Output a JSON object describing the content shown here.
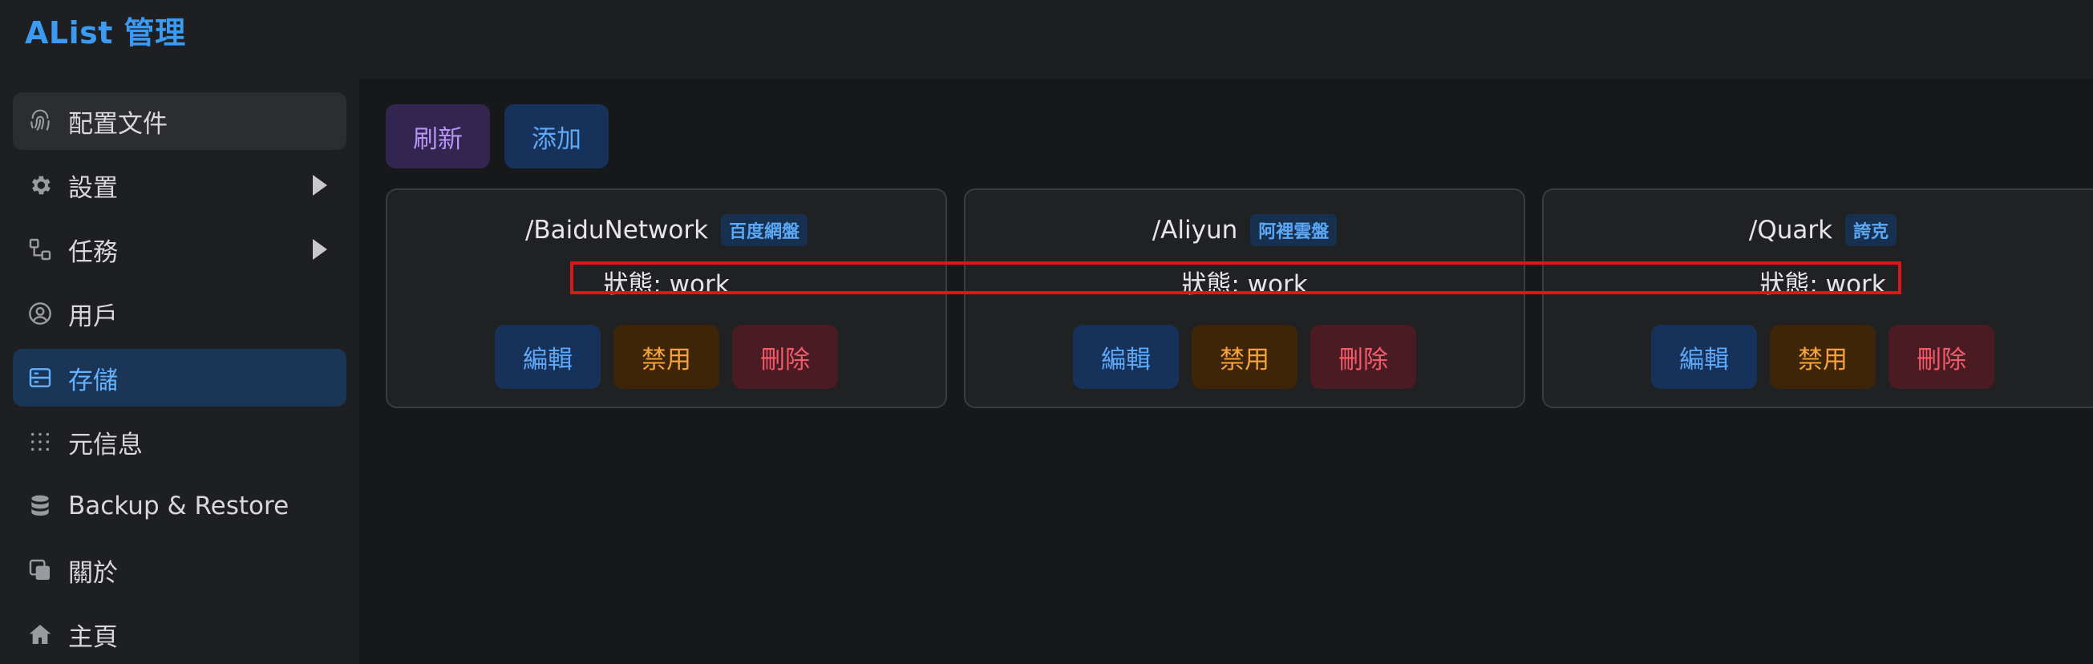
{
  "app": {
    "title": "AList 管理"
  },
  "sidebar": {
    "items": [
      {
        "label": "配置文件",
        "icon": "fingerprint-icon",
        "state": "hover"
      },
      {
        "label": "設置",
        "icon": "gear-icon",
        "expandable": true
      },
      {
        "label": "任務",
        "icon": "tasks-icon",
        "expandable": true
      },
      {
        "label": "用戶",
        "icon": "user-circle-icon"
      },
      {
        "label": "存儲",
        "icon": "storage-icon",
        "state": "active"
      },
      {
        "label": "元信息",
        "icon": "grid-dots-icon"
      },
      {
        "label": "Backup & Restore",
        "icon": "database-icon"
      },
      {
        "label": "關於",
        "icon": "copy-icon"
      },
      {
        "label": "主頁",
        "icon": "home-icon"
      }
    ]
  },
  "toolbar": {
    "refresh_label": "刷新",
    "add_label": "添加"
  },
  "storages": [
    {
      "path": "/BaiduNetwork",
      "driver": "百度網盤",
      "status": "狀態: work",
      "edit": "編輯",
      "disable": "禁用",
      "delete": "刪除"
    },
    {
      "path": "/Aliyun",
      "driver": "阿裡雲盤",
      "status": "狀態: work",
      "edit": "編輯",
      "disable": "禁用",
      "delete": "刪除"
    },
    {
      "path": "/Quark",
      "driver": "誇克",
      "status": "狀態: work",
      "edit": "編輯",
      "disable": "禁用",
      "delete": "刪除"
    }
  ],
  "colors": {
    "accent": "#3b9af2",
    "active_bg": "#1a3556",
    "highlight_box": "#e0151c"
  }
}
